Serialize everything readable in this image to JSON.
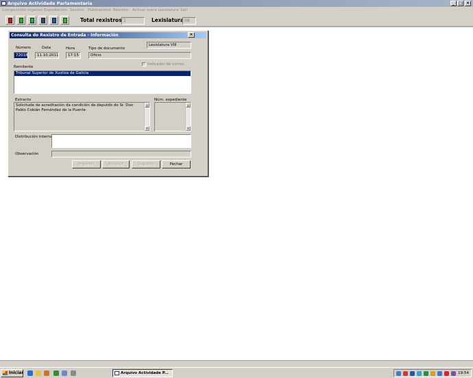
{
  "window": {
    "title": "Arquivo Actividade Parlamentaria",
    "btn_minimize": "_",
    "btn_maximize": "□",
    "btn_close": "×"
  },
  "menu": {
    "items": [
      "Composición órganos",
      "Expedientes",
      "Sesións",
      "Publicacións",
      "Rexistro",
      "Activar outra Lexislatura",
      "Saír"
    ]
  },
  "toolbar": {
    "total_label": "Total rexistros:",
    "total_value": "1",
    "lexislatura_label": "Lexislatura:",
    "lexislatura_value": "08",
    "icons": [
      "book-red-icon",
      "book-green-icon",
      "book-green-icon",
      "book-blue-icon",
      "book-blue-icon",
      "book-green-icon"
    ]
  },
  "side": {
    "close_glyph": "×"
  },
  "dialog": {
    "title": "Consulta do Rexistro de Entrada - Información",
    "close_glyph": "×",
    "lexislatura": "Lexislatura VIII",
    "numero_label": "Número",
    "numero_value": "72018",
    "data_label": "Data",
    "data_value": "11.10.2011",
    "hora_label": "Hora",
    "hora_value": "17:15",
    "tipo_label": "Tipo de documento",
    "tipo_value": "Oficio",
    "indicador_label": "Indicador de correo",
    "remitente_label": "Remitente",
    "remitente_items": [
      "Tribunal Superior de Xustiza de Galicia"
    ],
    "extracto_label": "Extracto",
    "extracto_value": "Solicitude de acreditación da condición de deputdo do Sr. Don Pablo Cobián Fernández de la Puente",
    "num_exp_label": "Núm. expediente",
    "distribucion_label": "Distribución interna",
    "observacion_label": "Observación",
    "buttons": {
      "imprimir": "Imprimir",
      "anterior": "Anterior",
      "seguinte": "Seguinte",
      "pechar": "Pechar"
    }
  },
  "taskbar": {
    "start_label": "Iniciar",
    "task_item": "Arquivo Actividade P...",
    "clock": "19:54"
  },
  "colors": {
    "dialog_title": "#0a246a",
    "selection": "#0a246a",
    "chrome": "#d4d0c8"
  }
}
